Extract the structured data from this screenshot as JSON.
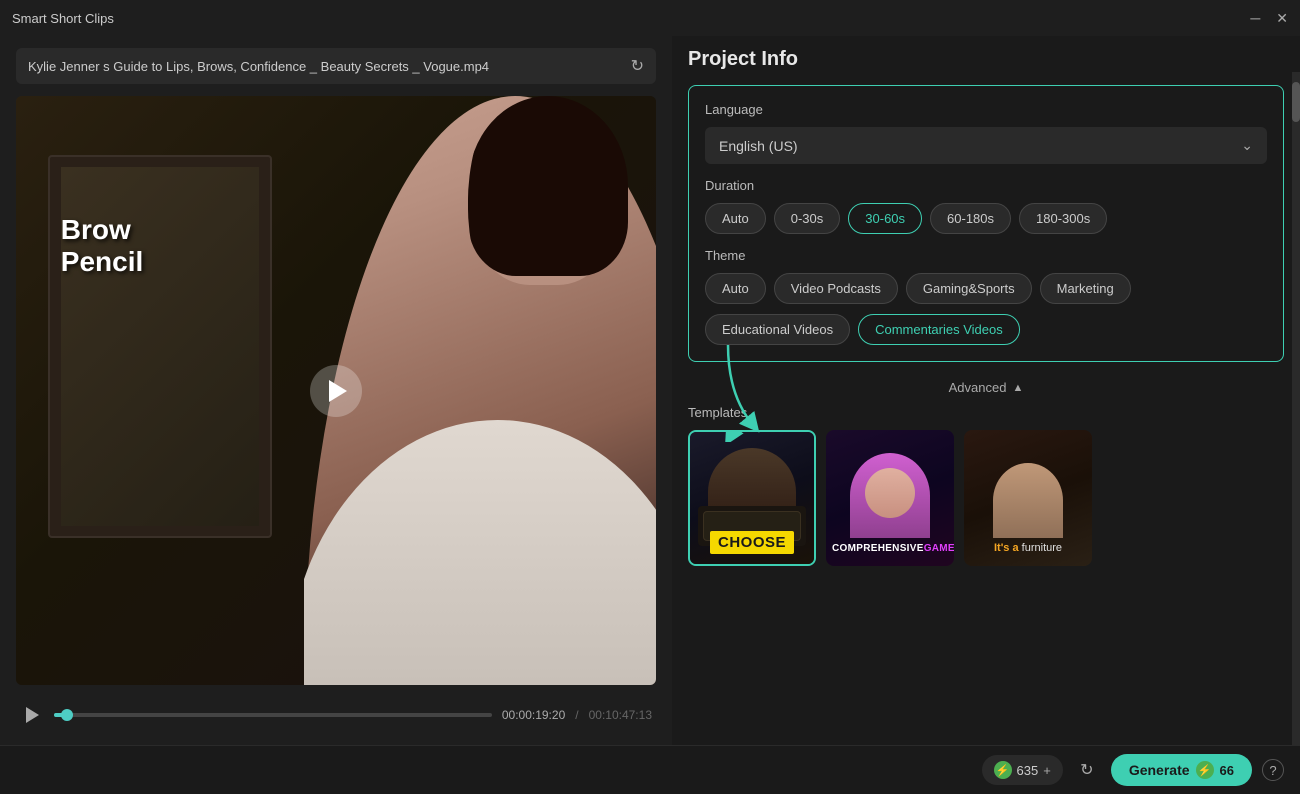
{
  "app": {
    "title": "Smart Short Clips",
    "minimize_label": "─",
    "close_label": "✕"
  },
  "left_panel": {
    "file_name": "Kylie Jenner s Guide to Lips, Brows, Confidence _ Beauty Secrets _ Vogue.mp4",
    "refresh_icon": "↻",
    "video_label": "Brow Pencil",
    "time_current": "00:00:19:20",
    "time_separator": "/",
    "time_total": "00:10:47:13"
  },
  "right_panel": {
    "project_info_title": "Project Info",
    "language_section_label": "Language",
    "language_value": "English (US)",
    "duration_section_label": "Duration",
    "duration_options": [
      {
        "label": "Auto",
        "active": false
      },
      {
        "label": "0-30s",
        "active": false
      },
      {
        "label": "30-60s",
        "active": true
      },
      {
        "label": "60-180s",
        "active": false
      },
      {
        "label": "180-300s",
        "active": false
      }
    ],
    "theme_section_label": "Theme",
    "theme_options_row1": [
      {
        "label": "Auto",
        "active": false
      },
      {
        "label": "Video Podcasts",
        "active": false
      },
      {
        "label": "Gaming&Sports",
        "active": false
      },
      {
        "label": "Marketing",
        "active": false
      }
    ],
    "theme_options_row2": [
      {
        "label": "Educational Videos",
        "active": false
      },
      {
        "label": "Commentaries Videos",
        "active": true
      }
    ],
    "advanced_label": "Advanced",
    "templates_label": "Templates",
    "templates": [
      {
        "id": "choose",
        "overlay_text": "CHOOSE",
        "selected": true
      },
      {
        "id": "comprehensive",
        "overlay_text_1": "COMPREHENSIVE",
        "overlay_text_2": "GAME",
        "selected": false
      },
      {
        "id": "furniture",
        "overlay_text_1": "It's a",
        "overlay_text_2": "furniture",
        "selected": false
      }
    ]
  },
  "bottom_bar": {
    "credits_icon": "⚡",
    "credits_count": "635",
    "credits_plus": "+",
    "refresh_icon": "↻",
    "generate_label": "Generate",
    "generate_icon": "⚡",
    "generate_count": "66",
    "help_icon": "?"
  }
}
